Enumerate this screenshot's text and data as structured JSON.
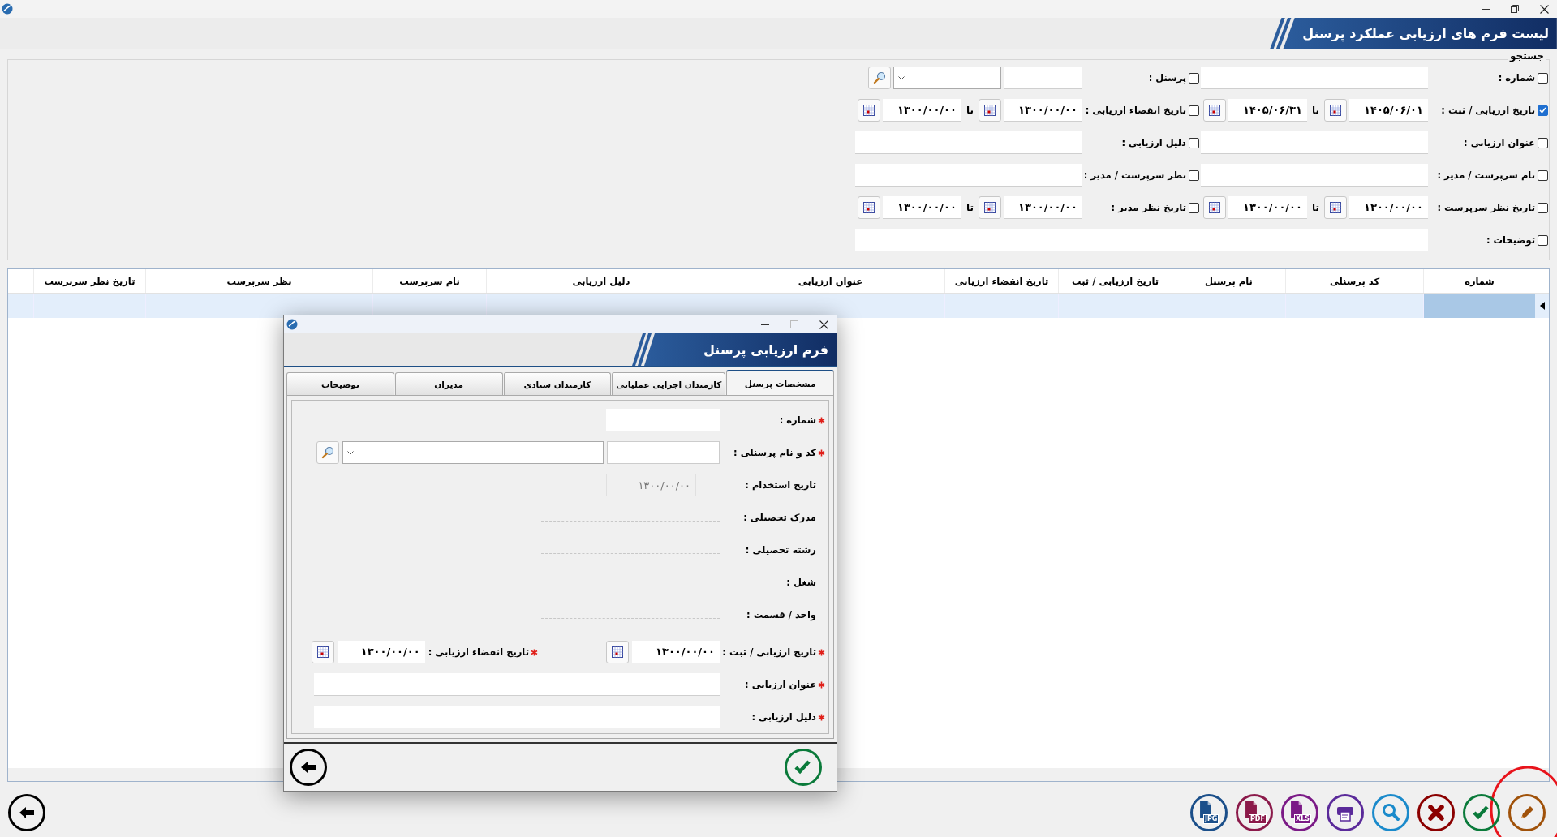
{
  "header": {
    "title": "لیست فرم های ارزیابی عملکرد پرسنل"
  },
  "search": {
    "legend": "جستجو",
    "rows": [
      [
        {
          "kind": "text",
          "label": "شماره :",
          "checked": false
        },
        {
          "kind": "lookup",
          "label": "پرسنل :",
          "checked": false
        }
      ],
      [
        {
          "kind": "date_range",
          "label": "تاریخ ارزیابی / ثبت :",
          "checked": true,
          "from": "۱۴۰۵/۰۶/۰۱",
          "to_label": "تا",
          "to": "۱۴۰۵/۰۶/۳۱"
        },
        {
          "kind": "date_range",
          "label": "تاریخ انقضاء ارزیابی :",
          "checked": false,
          "from": "۱۳۰۰/۰۰/۰۰",
          "to_label": "تا",
          "to": "۱۳۰۰/۰۰/۰۰"
        }
      ],
      [
        {
          "kind": "text",
          "label": "عنوان ارزیابی :",
          "checked": false
        },
        {
          "kind": "text",
          "label": "دلیل ارزیابی :",
          "checked": false
        }
      ],
      [
        {
          "kind": "text",
          "label": "نام سرپرست / مدیر :",
          "checked": false
        },
        {
          "kind": "text",
          "label": "نظر سرپرست / مدیر :",
          "checked": false
        }
      ],
      [
        {
          "kind": "date_range",
          "label": "تاریخ نظر سرپرست :",
          "checked": false,
          "from": "۱۳۰۰/۰۰/۰۰",
          "to_label": "تا",
          "to": "۱۳۰۰/۰۰/۰۰"
        },
        {
          "kind": "date_range",
          "label": "تاریخ نظر مدیر :",
          "checked": false,
          "from": "۱۳۰۰/۰۰/۰۰",
          "to_label": "تا",
          "to": "۱۳۰۰/۰۰/۰۰"
        }
      ],
      [
        {
          "kind": "wide",
          "label": "توضیحات :",
          "checked": false
        }
      ]
    ]
  },
  "table": {
    "columns": [
      "شماره",
      "کد پرسنلی",
      "نام پرسنل",
      "تاریخ ارزیابی / ثبت",
      "تاریخ انقضاء ارزیابی",
      "عنوان ارزیابی",
      "دلیل ارزیابی",
      "نام سرپرست",
      "نظر سرپرست",
      "تاریخ نظر سرپرست"
    ],
    "rows": [
      {
        "selected": true
      }
    ]
  },
  "toolbar": {
    "buttons": [
      {
        "kind": "edit",
        "highlighted": true
      },
      {
        "kind": "confirm",
        "highlighted": false
      },
      {
        "kind": "delete",
        "highlighted": false
      },
      {
        "kind": "search",
        "highlighted": false
      },
      {
        "kind": "print",
        "highlighted": false
      },
      {
        "kind": "xls",
        "label": "XLS",
        "highlighted": false
      },
      {
        "kind": "pdf",
        "label": "PDF",
        "highlighted": false
      },
      {
        "kind": "jpg",
        "label": "JPG",
        "highlighted": false
      }
    ]
  },
  "dialog": {
    "title": "فرم ارزیابی پرسنل",
    "tabs": [
      {
        "label": "مشخصات پرسنل",
        "selected": true
      },
      {
        "label": "کارمندان اجرایی عملیاتی",
        "selected": false
      },
      {
        "label": "کارمندان ستادی",
        "selected": false
      },
      {
        "label": "مدیران",
        "selected": false
      },
      {
        "label": "توضیحات",
        "selected": false
      }
    ],
    "fields": [
      {
        "kind": "text",
        "label": "شماره :",
        "required": true
      },
      {
        "kind": "lookup",
        "label": "کد و نام پرسنلی :",
        "required": true
      },
      {
        "kind": "readonly",
        "label": "تاریخ استخدام :",
        "required": false,
        "value": "۱۳۰۰/۰۰/۰۰"
      },
      {
        "kind": "display",
        "label": "مدرک تحصیلی :",
        "required": false
      },
      {
        "kind": "display",
        "label": "رشته تحصیلی :",
        "required": false
      },
      {
        "kind": "display",
        "label": "شغل :",
        "required": false
      },
      {
        "kind": "display",
        "label": "واحد / قسمت :",
        "required": false
      },
      {
        "kind": "date_pair",
        "label": "تاریخ ارزیابی / ثبت :",
        "required": true,
        "value": "۱۳۰۰/۰۰/۰۰",
        "second_label": "تاریخ انقضاء ارزیابی :",
        "second_required": true,
        "second_value": "۱۳۰۰/۰۰/۰۰"
      },
      {
        "kind": "wide",
        "label": "عنوان ارزیابی :",
        "required": true
      },
      {
        "kind": "wide",
        "label": "دلیل ارزیابی :",
        "required": true
      }
    ]
  }
}
